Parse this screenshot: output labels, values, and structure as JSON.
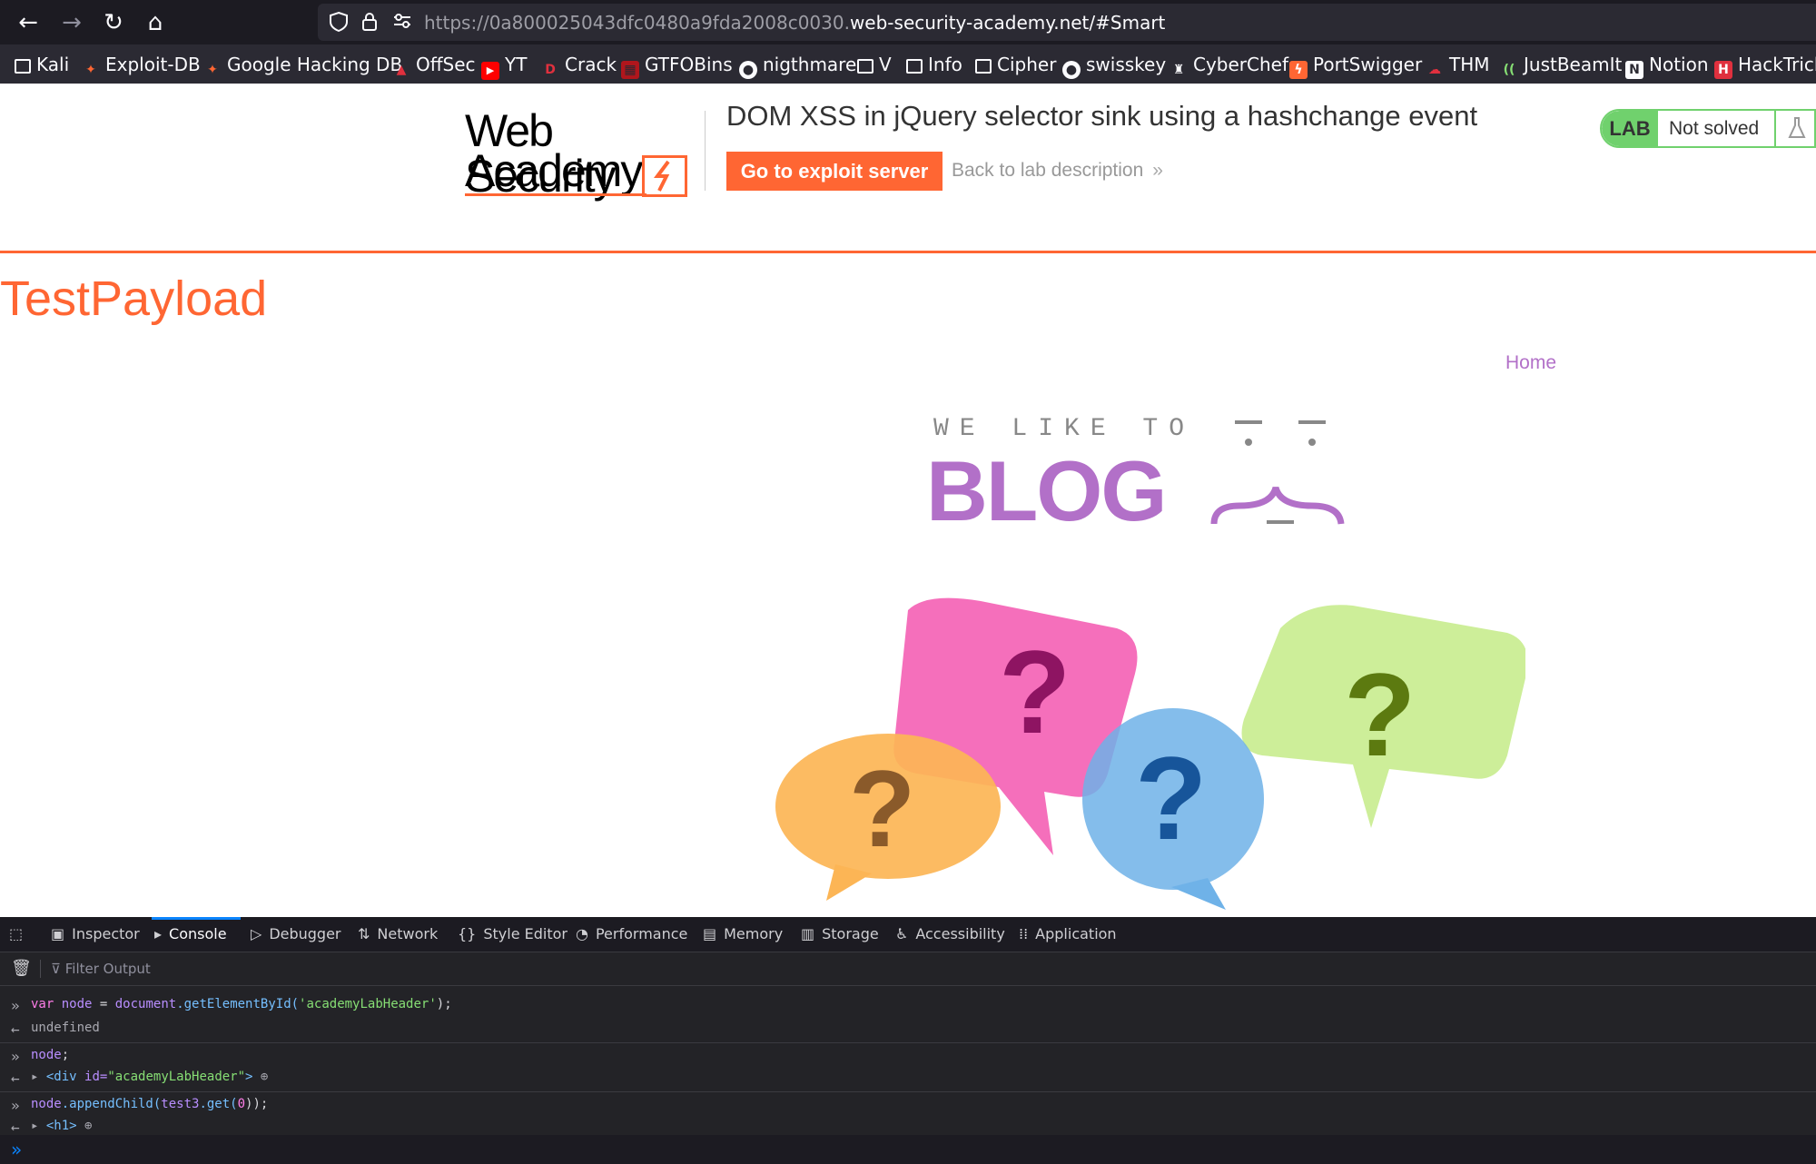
{
  "browser": {
    "url_dim": "https://0a800025043dfc0480a9fda2008c0030.",
    "url_main": "web-security-academy.net/#Smart",
    "bookmarks": [
      {
        "label": "Kali",
        "icon": "folder-icon"
      },
      {
        "label": "Exploit-DB",
        "icon": "exploitdb-icon"
      },
      {
        "label": "Google Hacking DB",
        "icon": "ghdb-icon"
      },
      {
        "label": "OffSec",
        "icon": "offsec-icon"
      },
      {
        "label": "YT",
        "icon": "youtube-icon"
      },
      {
        "label": "Crack",
        "icon": "crack-icon"
      },
      {
        "label": "GTFOBins",
        "icon": "gtfobins-icon"
      },
      {
        "label": "nigthmare",
        "icon": "github-icon"
      },
      {
        "label": "V",
        "icon": "folder-icon"
      },
      {
        "label": "Info",
        "icon": "folder-icon"
      },
      {
        "label": "Cipher",
        "icon": "folder-icon"
      },
      {
        "label": "swisskey",
        "icon": "github-icon"
      },
      {
        "label": "CyberChef",
        "icon": "cyberchef-icon"
      },
      {
        "label": "PortSwigger",
        "icon": "portswigger-icon"
      },
      {
        "label": "THM",
        "icon": "thm-icon"
      },
      {
        "label": "JustBeamIt",
        "icon": "justbeamit-icon"
      },
      {
        "label": "Notion",
        "icon": "notion-icon"
      },
      {
        "label": "HackTricks",
        "icon": "hacktricks-icon"
      }
    ]
  },
  "lab": {
    "logo_line1": "Web Security",
    "logo_line2": "Academy",
    "title": "DOM XSS in jQuery selector sink using a hashchange event",
    "exploit_button": "Go to exploit server",
    "back_link": "Back to lab description",
    "back_chevron": "»",
    "badge": "LAB",
    "status": "Not solved"
  },
  "page": {
    "heading": "TestPayload",
    "home_link": "Home",
    "banner_top": "WE LIKE TO",
    "banner_big": "BLOG"
  },
  "devtools": {
    "tabs": [
      {
        "label": "Inspector",
        "icon": "inspector-icon"
      },
      {
        "label": "Console",
        "icon": "console-icon"
      },
      {
        "label": "Debugger",
        "icon": "debugger-icon"
      },
      {
        "label": "Network",
        "icon": "network-icon"
      },
      {
        "label": "Style Editor",
        "icon": "style-editor-icon"
      },
      {
        "label": "Performance",
        "icon": "performance-icon"
      },
      {
        "label": "Memory",
        "icon": "memory-icon"
      },
      {
        "label": "Storage",
        "icon": "storage-icon"
      },
      {
        "label": "Accessibility",
        "icon": "accessibility-icon"
      },
      {
        "label": "Application",
        "icon": "application-icon"
      }
    ],
    "active_tab": "Console",
    "filter_placeholder": "Filter Output",
    "console": {
      "cmd1_kw": "var",
      "cmd1_var": "node",
      "cmd1_eq": " = ",
      "cmd1_obj": "document",
      "cmd1_fn": ".getElementById(",
      "cmd1_str": "'academyLabHeader'",
      "cmd1_end": ");",
      "res1": "undefined",
      "cmd2": "node",
      "cmd2_end": ";",
      "res2_open": "<",
      "res2_tag": "div",
      "res2_attr": " id=",
      "res2_val": "\"academyLabHeader\"",
      "res2_close": ">",
      "cmd3_var": "node",
      "cmd3_fn": ".appendChild(",
      "cmd3_arg": "test3",
      "cmd3_fn2": ".get(",
      "cmd3_num": "0",
      "cmd3_end": "));",
      "res3_open": "<",
      "res3_tag": "h1",
      "res3_close": ">"
    }
  },
  "colors": {
    "accent": "#ff6633",
    "lab_green": "#70d16d",
    "blog_purple": "#b270c8",
    "devtools_bg": "#232327"
  }
}
